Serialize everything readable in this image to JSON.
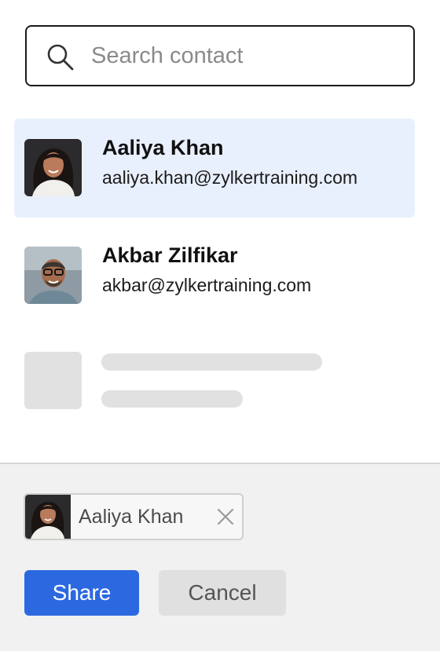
{
  "search": {
    "placeholder": "Search contact",
    "icon": "search-icon"
  },
  "contacts": [
    {
      "name": "Aaliya Khan",
      "email": "aaliya.khan@zylkertraining.com",
      "selected": true,
      "avatar": "woman-portrait"
    },
    {
      "name": "Akbar Zilfikar",
      "email": "akbar@zylkertraining.com",
      "selected": false,
      "avatar": "man-portrait"
    }
  ],
  "selected_chips": [
    {
      "label": "Aaliya Khan",
      "avatar": "woman-portrait",
      "remove_icon": "close-icon"
    }
  ],
  "actions": {
    "share_label": "Share",
    "cancel_label": "Cancel"
  },
  "colors": {
    "accent": "#2c69e1",
    "selected_row": "#e9f0fd",
    "skeleton": "#e1e1e1",
    "footer_bg": "#f1f1f1"
  }
}
